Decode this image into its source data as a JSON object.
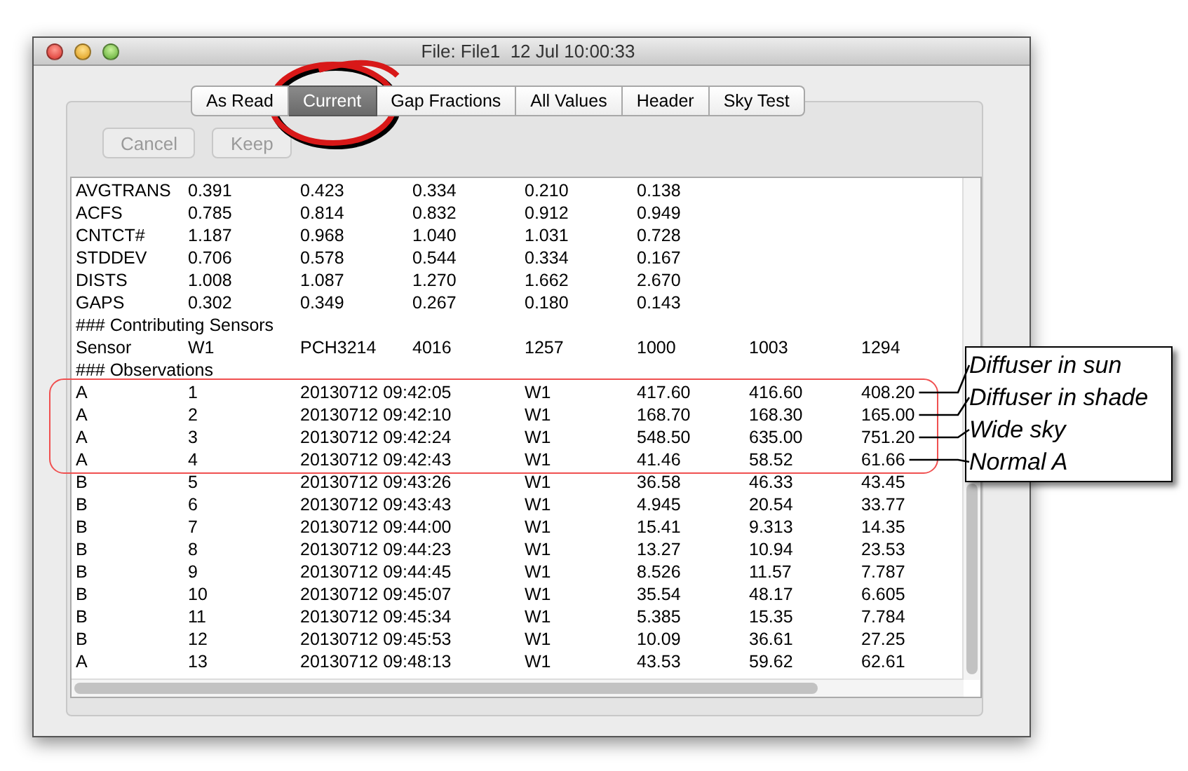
{
  "window": {
    "title": "File: File1  12 Jul 10:00:33"
  },
  "tabs": [
    {
      "label": "As Read",
      "selected": false,
      "circled": false
    },
    {
      "label": "Current",
      "selected": true,
      "circled": true
    },
    {
      "label": "Gap Fractions",
      "selected": false,
      "circled": false
    },
    {
      "label": "All Values",
      "selected": false,
      "circled": false
    },
    {
      "label": "Header",
      "selected": false,
      "circled": false
    },
    {
      "label": "Sky Test",
      "selected": false,
      "circled": false
    }
  ],
  "buttons": [
    {
      "label": "Cancel",
      "disabled": true
    },
    {
      "label": "Keep",
      "disabled": true
    }
  ],
  "lines": [
    {
      "kind": "values",
      "cells": [
        "AVGTRANS",
        "0.391",
        "0.423",
        "0.334",
        "0.210",
        "0.138"
      ]
    },
    {
      "kind": "values",
      "cells": [
        "ACFS",
        "0.785",
        "0.814",
        "0.832",
        "0.912",
        "0.949"
      ]
    },
    {
      "kind": "values",
      "cells": [
        "CNTCT#",
        "1.187",
        "0.968",
        "1.040",
        "1.031",
        "0.728"
      ]
    },
    {
      "kind": "values",
      "cells": [
        "STDDEV",
        "0.706",
        "0.578",
        "0.544",
        "0.334",
        "0.167"
      ]
    },
    {
      "kind": "values",
      "cells": [
        "DISTS",
        "1.008",
        "1.087",
        "1.270",
        "1.662",
        "2.670"
      ]
    },
    {
      "kind": "values",
      "cells": [
        "GAPS",
        "0.302",
        "0.349",
        "0.267",
        "0.180",
        "0.143"
      ]
    },
    {
      "kind": "heading",
      "text": "### Contributing Sensors"
    },
    {
      "kind": "values",
      "cells": [
        "Sensor",
        "W1",
        "PCH3214",
        "4016",
        "1257",
        "1000",
        "1003",
        "1294"
      ]
    },
    {
      "kind": "heading",
      "text": "### Observations"
    },
    {
      "kind": "observation",
      "highlighted": true,
      "callout": "Diffuser in sun",
      "cells": [
        "A",
        "1",
        "20130712 09:42:05",
        "W1",
        "417.60",
        "416.60",
        "408.20"
      ]
    },
    {
      "kind": "observation",
      "highlighted": true,
      "callout": "Diffuser in shade",
      "cells": [
        "A",
        "2",
        "20130712 09:42:10",
        "W1",
        "168.70",
        "168.30",
        "165.00"
      ]
    },
    {
      "kind": "observation",
      "highlighted": true,
      "callout": "Wide sky",
      "cells": [
        "A",
        "3",
        "20130712 09:42:24",
        "W1",
        "548.50",
        "635.00",
        "751.20"
      ]
    },
    {
      "kind": "observation",
      "highlighted": true,
      "callout": "Normal A",
      "cells": [
        "A",
        "4",
        "20130712 09:42:43",
        "W1",
        "41.46",
        "58.52",
        "61.66"
      ]
    },
    {
      "kind": "observation",
      "highlighted": false,
      "cells": [
        "B",
        "5",
        "20130712 09:43:26",
        "W1",
        "36.58",
        "46.33",
        "43.45"
      ]
    },
    {
      "kind": "observation",
      "highlighted": false,
      "cells": [
        "B",
        "6",
        "20130712 09:43:43",
        "W1",
        "4.945",
        "20.54",
        "33.77"
      ]
    },
    {
      "kind": "observation",
      "highlighted": false,
      "cells": [
        "B",
        "7",
        "20130712 09:44:00",
        "W1",
        "15.41",
        "9.313",
        "14.35"
      ]
    },
    {
      "kind": "observation",
      "highlighted": false,
      "cells": [
        "B",
        "8",
        "20130712 09:44:23",
        "W1",
        "13.27",
        "10.94",
        "23.53"
      ]
    },
    {
      "kind": "observation",
      "highlighted": false,
      "cells": [
        "B",
        "9",
        "20130712 09:44:45",
        "W1",
        "8.526",
        "11.57",
        "7.787"
      ]
    },
    {
      "kind": "observation",
      "highlighted": false,
      "cells": [
        "B",
        "10",
        "20130712 09:45:07",
        "W1",
        "35.54",
        "48.17",
        "6.605"
      ]
    },
    {
      "kind": "observation",
      "highlighted": false,
      "cells": [
        "B",
        "11",
        "20130712 09:45:34",
        "W1",
        "5.385",
        "15.35",
        "7.784"
      ]
    },
    {
      "kind": "observation",
      "highlighted": false,
      "cells": [
        "B",
        "12",
        "20130712 09:45:53",
        "W1",
        "10.09",
        "36.61",
        "27.25"
      ]
    },
    {
      "kind": "observation",
      "highlighted": false,
      "cells": [
        "A",
        "13",
        "20130712 09:48:13",
        "W1",
        "43.53",
        "59.62",
        "62.61"
      ]
    }
  ]
}
